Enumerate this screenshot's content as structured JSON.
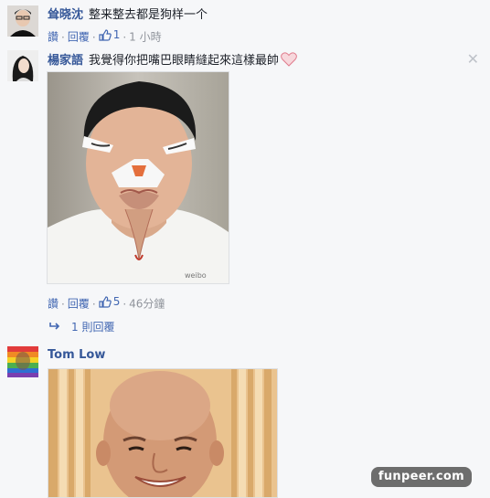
{
  "comments": [
    {
      "author": "耸晓沈",
      "text": "整来整去都是狗样一个",
      "actions": {
        "reply": "讚",
        "reply2": "回覆",
        "likes": "1",
        "time": "1 小時"
      }
    },
    {
      "author": "楊家語",
      "text": "我覺得你把嘴巴眼睛縫起來這樣最帥",
      "actions": {
        "reply": "讚",
        "reply2": "回覆",
        "likes": "5",
        "time": "46分鐘"
      },
      "replies": "1 則回覆",
      "photo_caption": "weibo"
    },
    {
      "author": "Tom Low"
    }
  ],
  "watermark": "funpeer.com",
  "colors": {
    "link": "#365899",
    "meta": "#90949c",
    "bg": "#f6f7f9"
  }
}
